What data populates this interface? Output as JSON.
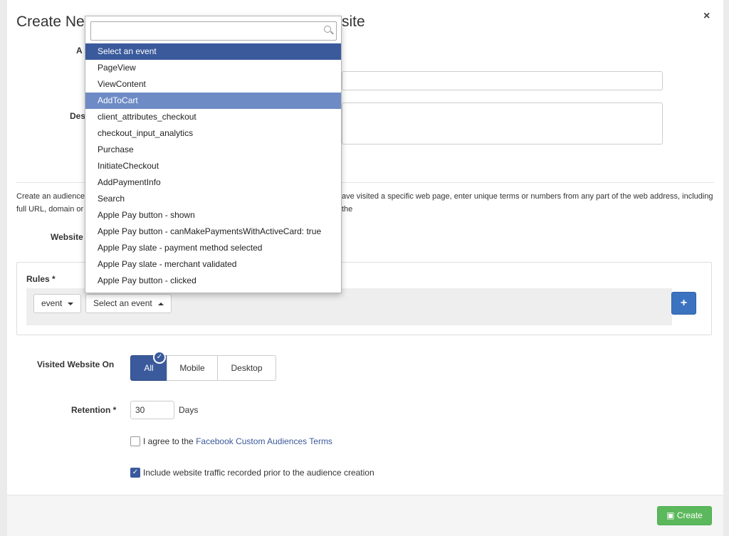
{
  "modal": {
    "title_left": "Create Ne",
    "title_right": "site",
    "close_glyph": "×"
  },
  "form": {
    "label_a": "A",
    "label_des": "Des",
    "description": "Create an audience",
    "description_right": "ave visited a specific web page, enter unique terms or numbers from any part of the web address, including the",
    "description_line2": "full URL, domain or p",
    "website_label": "Website",
    "rules_label": "Rules *",
    "event_button": "event",
    "select_event_button": "Select an event",
    "add_rule_glyph": "+",
    "visited_label": "Visited Website On",
    "segments": [
      "All",
      "Mobile",
      "Desktop"
    ],
    "retention_label": "Retention *",
    "retention_value": "30",
    "retention_unit": "Days",
    "terms_prefix": "I agree to the ",
    "terms_link": "Facebook Custom Audiences Terms",
    "terms_checked": false,
    "include_traffic_label": "Include website traffic recorded prior to the audience creation",
    "include_traffic_checked": true
  },
  "dropdown": {
    "search_placeholder": "",
    "items": [
      "Select an event",
      "PageView",
      "ViewContent",
      "AddToCart",
      "client_attributes_checkout",
      "checkout_input_analytics",
      "Purchase",
      "InitiateCheckout",
      "AddPaymentInfo",
      "Search",
      "Apple Pay button - shown",
      "Apple Pay button - canMakePaymentsWithActiveCard: true",
      "Apple Pay slate - payment method selected",
      "Apple Pay slate - merchant validated",
      "Apple Pay button - clicked"
    ],
    "selected_index": 0,
    "hover_index": 3
  },
  "footer": {
    "create_label": "Create"
  },
  "colors": {
    "primary": "#3a5a9c",
    "hover": "#6e8bc6",
    "success": "#5cb85c",
    "link": "#3b5998"
  }
}
